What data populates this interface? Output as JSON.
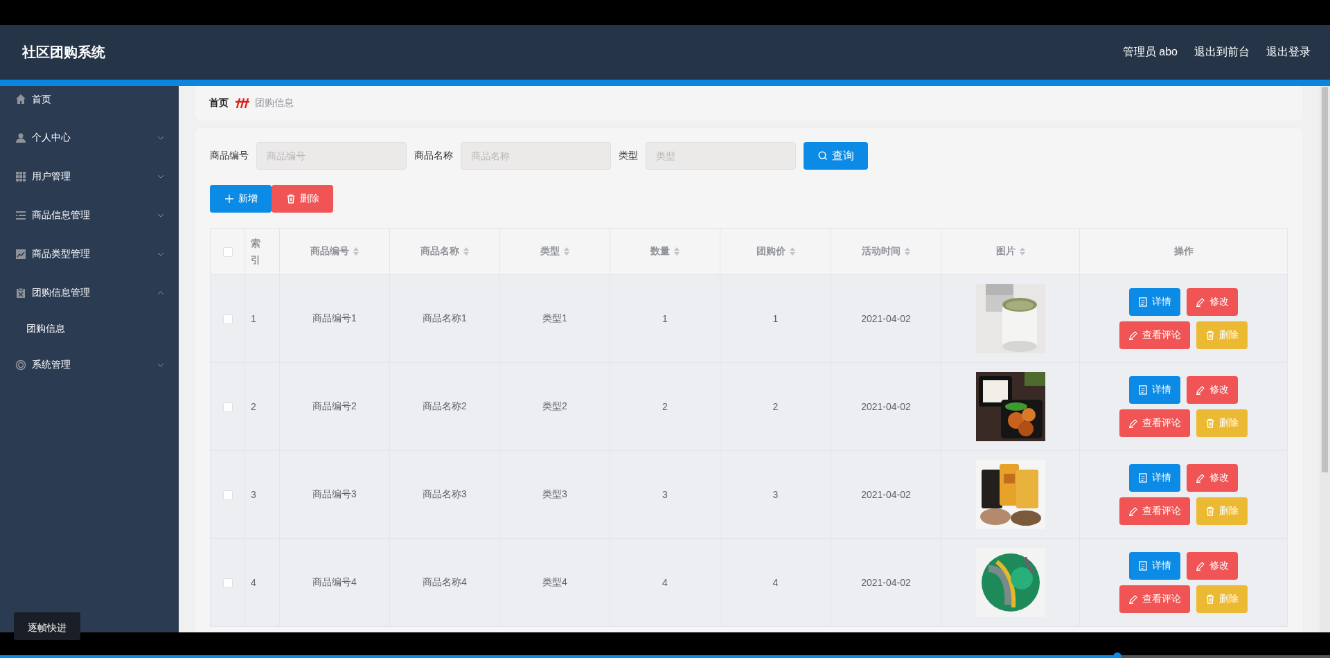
{
  "header": {
    "title": "社区团购系统",
    "links": [
      "管理员 abo",
      "退出到前台",
      "退出登录"
    ]
  },
  "sidebar": {
    "items": [
      {
        "label": "首页"
      },
      {
        "label": "个人中心",
        "expanded": false
      },
      {
        "label": "用户管理",
        "expanded": false
      },
      {
        "label": "商品信息管理",
        "expanded": false
      },
      {
        "label": "商品类型管理",
        "expanded": false
      },
      {
        "label": "团购信息管理",
        "expanded": true,
        "children": [
          {
            "label": "团购信息"
          }
        ]
      },
      {
        "label": "系统管理",
        "expanded": false
      }
    ]
  },
  "breadcrumb": [
    "首页",
    "团购信息"
  ],
  "search": {
    "fields": [
      {
        "label": "商品编号",
        "placeholder": "商品编号"
      },
      {
        "label": "商品名称",
        "placeholder": "商品名称"
      },
      {
        "label": "类型",
        "placeholder": "类型"
      }
    ],
    "button": "查询"
  },
  "toolbar": [
    {
      "label": "新增",
      "kind": "add"
    },
    {
      "label": "删除",
      "kind": "delete"
    }
  ],
  "table": {
    "all_checked": false,
    "columns": [
      {
        "label": "索引",
        "sortable": false
      },
      {
        "label": "商品编号",
        "sortable": true
      },
      {
        "label": "商品名称",
        "sortable": true
      },
      {
        "label": "类型",
        "sortable": true
      },
      {
        "label": "数量",
        "sortable": true
      },
      {
        "label": "团购价",
        "sortable": true
      },
      {
        "label": "活动时间",
        "sortable": true
      },
      {
        "label": "图片",
        "sortable": true
      },
      {
        "label": "操作",
        "sortable": false
      }
    ],
    "rows": [
      {
        "checked": false,
        "cells": [
          "1",
          "商品编号1",
          "商品名称1",
          "类型1",
          "1",
          "1",
          "2021-04-02"
        ],
        "actions": [
          {
            "label": "详情",
            "kind": "detail"
          },
          {
            "label": "修改",
            "kind": "edit"
          },
          {
            "label": "查看评论",
            "kind": "comment"
          },
          {
            "label": "删除",
            "kind": "delete"
          }
        ]
      },
      {
        "checked": false,
        "cells": [
          "2",
          "商品编号2",
          "商品名称2",
          "类型2",
          "2",
          "2",
          "2021-04-02"
        ],
        "actions": [
          {
            "label": "详情",
            "kind": "detail"
          },
          {
            "label": "修改",
            "kind": "edit"
          },
          {
            "label": "查看评论",
            "kind": "comment"
          },
          {
            "label": "删除",
            "kind": "delete"
          }
        ]
      },
      {
        "checked": false,
        "cells": [
          "3",
          "商品编号3",
          "商品名称3",
          "类型3",
          "3",
          "3",
          "2021-04-02"
        ],
        "actions": [
          {
            "label": "详情",
            "kind": "detail"
          },
          {
            "label": "修改",
            "kind": "edit"
          },
          {
            "label": "查看评论",
            "kind": "comment"
          },
          {
            "label": "删除",
            "kind": "delete"
          }
        ]
      },
      {
        "checked": false,
        "cells": [
          "4",
          "商品编号4",
          "商品名称4",
          "类型4",
          "4",
          "4",
          "2021-04-02"
        ],
        "actions": [
          {
            "label": "详情",
            "kind": "detail"
          },
          {
            "label": "修改",
            "kind": "edit"
          },
          {
            "label": "查看评论",
            "kind": "comment"
          },
          {
            "label": "删除",
            "kind": "delete"
          }
        ]
      }
    ]
  },
  "player": {
    "tooltip": "逐帧快进",
    "progress": {
      "level": 0.84
    }
  }
}
